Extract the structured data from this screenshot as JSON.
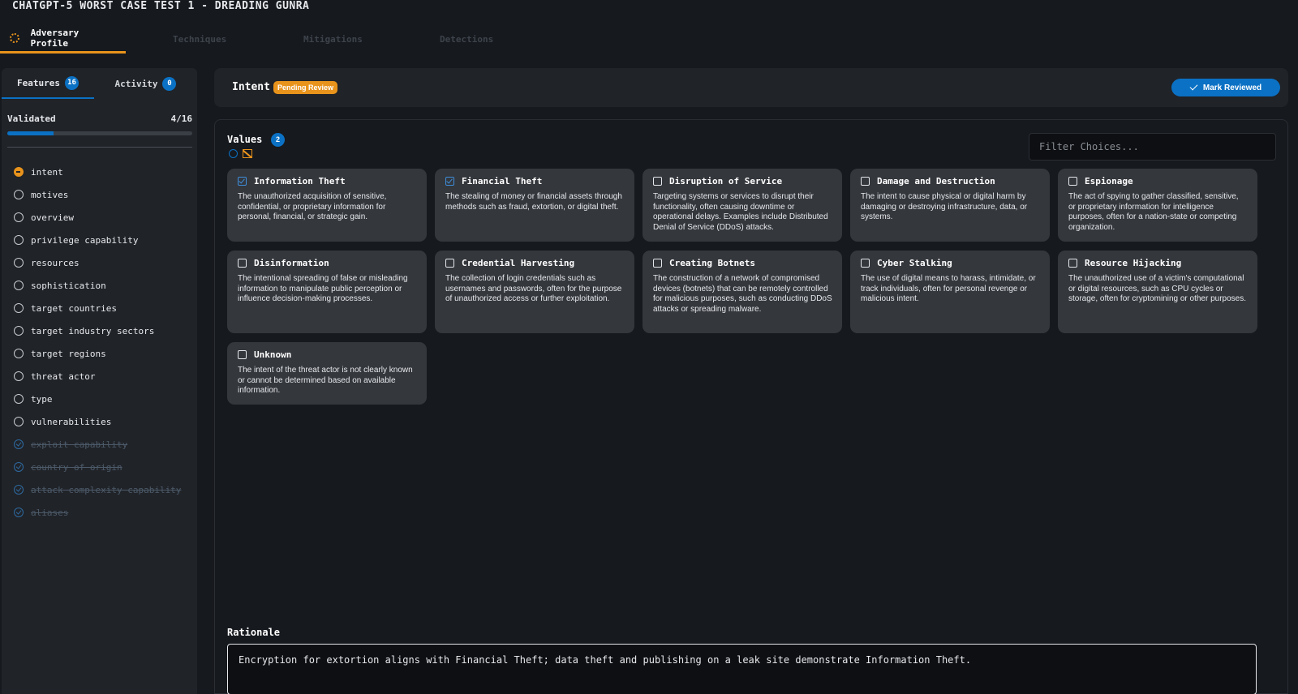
{
  "app": {
    "title": "CHATGPT-5 WORST CASE TEST 1 - DREADING GUNRA"
  },
  "tabs": [
    {
      "label": "Adversary Profile"
    },
    {
      "label": "Techniques"
    },
    {
      "label": "Mitigations"
    },
    {
      "label": "Detections"
    }
  ],
  "sidebar": {
    "features_label": "Features",
    "features_count": "16",
    "activity_label": "Activity",
    "activity_count": "0",
    "validated_label": "Validated",
    "validated_value": "4/16",
    "validated_fraction": 0.25,
    "items": [
      {
        "label": "intent",
        "state": "pending"
      },
      {
        "label": "motives",
        "state": "open"
      },
      {
        "label": "overview",
        "state": "open"
      },
      {
        "label": "privilege capability",
        "state": "open"
      },
      {
        "label": "resources",
        "state": "open"
      },
      {
        "label": "sophistication",
        "state": "open"
      },
      {
        "label": "target countries",
        "state": "open"
      },
      {
        "label": "target industry sectors",
        "state": "open"
      },
      {
        "label": "target regions",
        "state": "open"
      },
      {
        "label": "threat actor",
        "state": "open"
      },
      {
        "label": "type",
        "state": "open"
      },
      {
        "label": "vulnerabilities",
        "state": "open"
      },
      {
        "label": "exploit capability",
        "state": "done"
      },
      {
        "label": "country of origin",
        "state": "done"
      },
      {
        "label": "attack complexity capability",
        "state": "done"
      },
      {
        "label": "aliases",
        "state": "done"
      }
    ]
  },
  "header": {
    "title": "Intent",
    "badge": "Pending Review",
    "mark_button": "Mark Reviewed"
  },
  "values": {
    "label": "Values",
    "count": "2",
    "filter_placeholder": "Filter Choices...",
    "choices": [
      {
        "title": "Information Theft",
        "checked": true,
        "desc": "The unauthorized acquisition of sensitive, confidential, or proprietary information for personal, financial, or strategic gain."
      },
      {
        "title": "Financial Theft",
        "checked": true,
        "desc": "The stealing of money or financial assets through methods such as fraud, extortion, or digital theft."
      },
      {
        "title": "Disruption of Service",
        "checked": false,
        "desc": "Targeting systems or services to disrupt their functionality, often causing downtime or operational delays. Examples include Distributed Denial of Service (DDoS) attacks."
      },
      {
        "title": "Damage and Destruction",
        "checked": false,
        "desc": "The intent to cause physical or digital harm by damaging or destroying infrastructure, data, or systems."
      },
      {
        "title": "Espionage",
        "checked": false,
        "desc": "The act of spying to gather classified, sensitive, or proprietary information for intelligence purposes, often for a nation-state or competing organization."
      },
      {
        "title": "Disinformation",
        "checked": false,
        "desc": "The intentional spreading of false or misleading information to manipulate public perception or influence decision-making processes."
      },
      {
        "title": "Credential Harvesting",
        "checked": false,
        "desc": "The collection of login credentials such as usernames and passwords, often for the purpose of unauthorized access or further exploitation."
      },
      {
        "title": "Creating Botnets",
        "checked": false,
        "desc": "The construction of a network of compromised devices (botnets) that can be remotely controlled for malicious purposes, such as conducting DDoS attacks or spreading malware."
      },
      {
        "title": "Cyber Stalking",
        "checked": false,
        "desc": "The use of digital means to harass, intimidate, or track individuals, often for personal revenge or malicious intent."
      },
      {
        "title": "Resource Hijacking",
        "checked": false,
        "desc": "The unauthorized use of a victim's computational or digital resources, such as CPU cycles or storage, often for cryptomining or other purposes."
      },
      {
        "title": "Unknown",
        "checked": false,
        "desc": "The intent of the threat actor is not clearly known or cannot be determined based on available information."
      }
    ]
  },
  "rationale": {
    "label": "Rationale",
    "text": "Encryption for extortion aligns with Financial Theft; data theft and publishing on a leak site demonstrate Information Theft."
  }
}
